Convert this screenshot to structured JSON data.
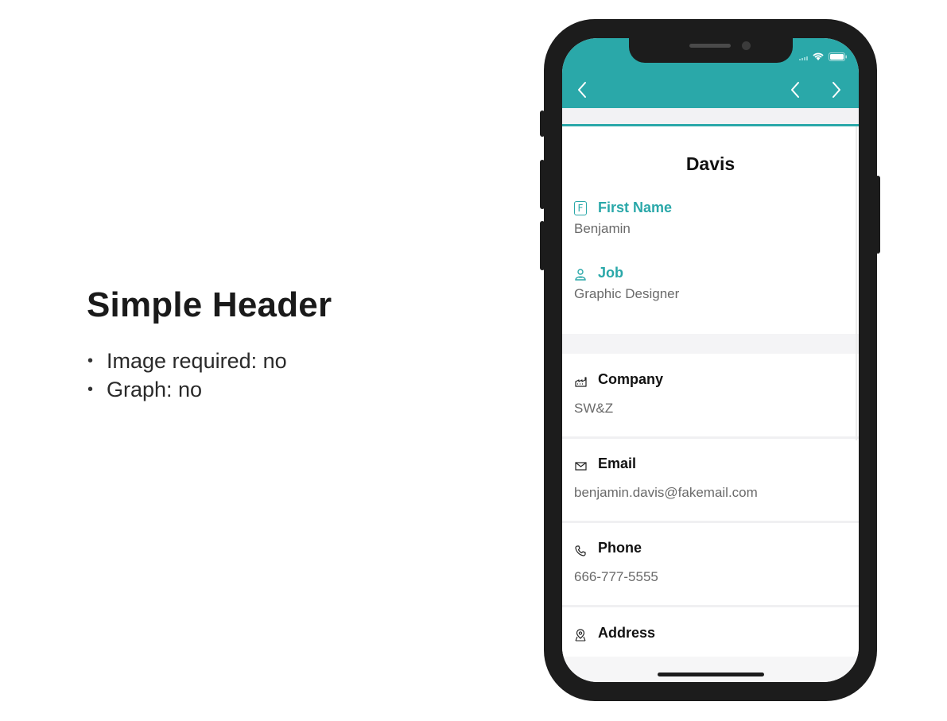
{
  "slide": {
    "title": "Simple Header",
    "bullets": [
      "Image required: no",
      "Graph: no"
    ]
  },
  "app": {
    "accent_color": "#2aa8a9",
    "nav": {
      "back_icon": "chevron-left-icon",
      "prev_icon": "chevron-left-icon",
      "next_icon": "chevron-right-icon"
    },
    "record_title": "Davis",
    "fields": [
      {
        "label": "First Name",
        "value": "Benjamin",
        "icon": "f-letter-icon"
      },
      {
        "label": "Job",
        "value": "Graphic Designer",
        "icon": "person-icon"
      },
      {
        "label": "Company",
        "value": "SW&Z",
        "icon": "factory-icon"
      },
      {
        "label": "Email",
        "value": "benjamin.davis@fakemail.com",
        "icon": "envelope-icon"
      },
      {
        "label": "Phone",
        "value": "666-777-5555",
        "icon": "phone-icon"
      },
      {
        "label": "Address",
        "value": "",
        "icon": "map-pin-icon"
      }
    ]
  }
}
